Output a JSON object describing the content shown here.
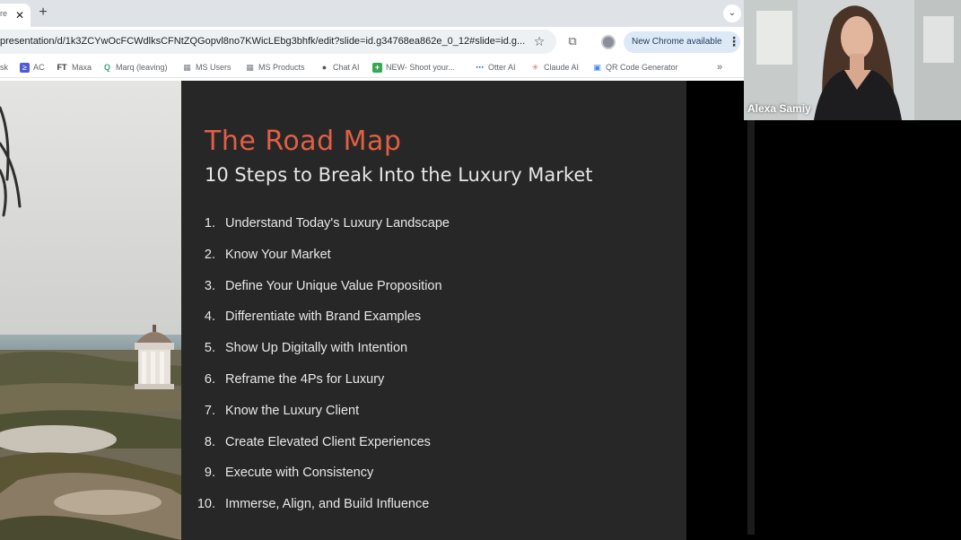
{
  "browser": {
    "tab": {
      "title": "re",
      "close_glyph": "✕"
    },
    "new_tab_glyph": "+",
    "tab_menu_glyph": "⌄",
    "address": "presentation/d/1k3ZCYwOcFCWdlksCFNtZQGopvl8no7KWicLEbg3bhfk/edit?slide=id.g34768ea862e_0_12#slide=id.g...",
    "star_glyph": "☆",
    "extensions_glyph": "⧉",
    "update_button": "New Chrome available",
    "menu_glyph": "⋮",
    "bookmarks": [
      {
        "label": "sk",
        "icon": "none"
      },
      {
        "label": "AC",
        "icon": "ac-icon",
        "glyph": "≥"
      },
      {
        "label": "Maxa",
        "icon": "ft-icon",
        "glyph": "FT"
      },
      {
        "label": "Marq (leaving)",
        "icon": "marq-icon",
        "glyph": "Q"
      },
      {
        "label": "MS Users",
        "icon": "ms-icon",
        "glyph": "▦"
      },
      {
        "label": "MS Products",
        "icon": "ms-icon",
        "glyph": "▦"
      },
      {
        "label": "Chat AI",
        "icon": "chat-icon",
        "glyph": "●"
      },
      {
        "label": "NEW- Shoot your...",
        "icon": "plus-icon",
        "glyph": "+"
      },
      {
        "label": "Otter AI",
        "icon": "otter-icon",
        "glyph": "⋯"
      },
      {
        "label": "Claude AI",
        "icon": "claude-icon",
        "glyph": "✳"
      },
      {
        "label": "QR Code Generator",
        "icon": "qr-icon",
        "glyph": "▣"
      }
    ],
    "overflow_glyph": "»"
  },
  "slide": {
    "title": "The Road Map",
    "subtitle": "10 Steps to Break Into the Luxury Market",
    "steps": [
      {
        "num": "1.",
        "text": "Understand Today's Luxury Landscape"
      },
      {
        "num": "2.",
        "text": "Know Your Market"
      },
      {
        "num": "3.",
        "text": "Define Your Unique Value Proposition"
      },
      {
        "num": "4.",
        "text": "Differentiate with Brand Examples"
      },
      {
        "num": "5.",
        "text": "Show Up Digitally with Intention"
      },
      {
        "num": "6.",
        "text": "Reframe the 4Ps for Luxury"
      },
      {
        "num": "7.",
        "text": "Know the Luxury Client"
      },
      {
        "num": "8.",
        "text": "Create Elevated Client Experiences"
      },
      {
        "num": "9.",
        "text": "Execute with Consistency"
      },
      {
        "num": "10.",
        "text": "Immerse, Align, and Build Influence"
      }
    ]
  },
  "video": {
    "participant": "Alexa Samiy"
  },
  "colors": {
    "title_accent": "#e15f45",
    "slide_bg": "#272727",
    "update_pill": "#dde9f6"
  }
}
